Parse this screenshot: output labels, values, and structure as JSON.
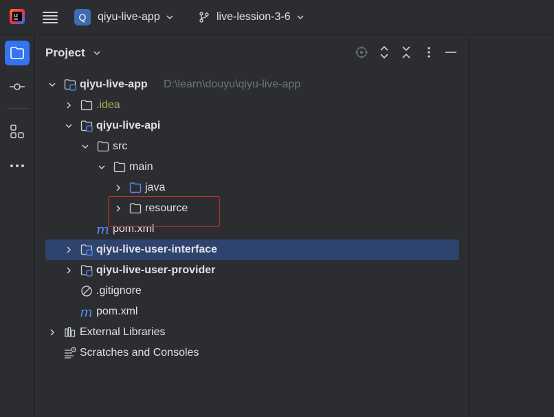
{
  "titlebar": {
    "project_badge": "Q",
    "project_name": "qiyu-live-app",
    "branch_name": "live-lession-3-6"
  },
  "panel": {
    "title": "Project"
  },
  "tree": {
    "root": {
      "label": "qiyu-live-app",
      "path": "D:\\learn\\douyu\\qiyu-live-app"
    },
    "idea": {
      "label": ".idea"
    },
    "api": {
      "label": "qiyu-live-api"
    },
    "src": {
      "label": "src"
    },
    "main": {
      "label": "main"
    },
    "java": {
      "label": "java"
    },
    "resource": {
      "label": "resource"
    },
    "api_pom": {
      "label": "pom.xml",
      "icon_text": "m"
    },
    "user_interface": {
      "label": "qiyu-live-user-interface"
    },
    "user_provider": {
      "label": "qiyu-live-user-provider"
    },
    "gitignore": {
      "label": ".gitignore"
    },
    "root_pom": {
      "label": "pom.xml",
      "icon_text": "m"
    },
    "external_libraries": {
      "label": "External Libraries"
    },
    "scratches": {
      "label": "Scratches and Consoles"
    }
  },
  "colors": {
    "background": "#2b2d30",
    "selection": "#2e436e",
    "accent": "#3574f0",
    "highlight_box": "#c7302a",
    "ignored_text": "#b3ae60"
  }
}
